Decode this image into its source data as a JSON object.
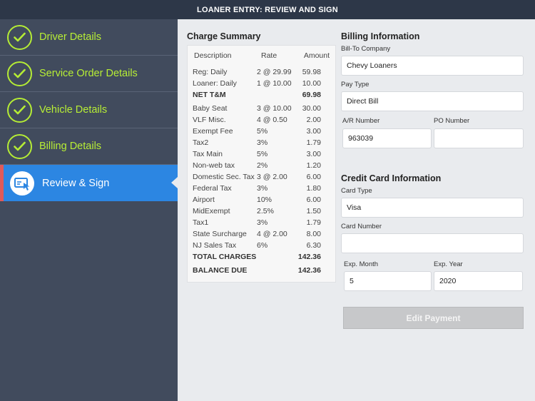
{
  "header": {
    "title": "LOANER ENTRY:  REVIEW AND SIGN"
  },
  "sidebar": {
    "items": [
      {
        "label": "Driver Details",
        "icon": "check-circle-icon"
      },
      {
        "label": "Service Order Details",
        "icon": "check-circle-icon"
      },
      {
        "label": "Vehicle Details",
        "icon": "check-circle-icon"
      },
      {
        "label": "Billing Details",
        "icon": "check-circle-icon"
      },
      {
        "label": "Review & Sign",
        "icon": "sign-document-icon"
      }
    ],
    "colors": {
      "check": "#b5ec35",
      "active": "#2c86e2",
      "active_marker": "#e05a5a",
      "background": "#414b5d"
    }
  },
  "charge_summary": {
    "title": "Charge Summary",
    "columns": {
      "description": "Description",
      "rate": "Rate",
      "amount": "Amount"
    },
    "rows": [
      {
        "description": "Reg: Daily",
        "rate": "2 @ 29.99",
        "amount": "59.98"
      },
      {
        "description": "Loaner: Daily",
        "rate": "1 @ 10.00",
        "amount": "10.00"
      },
      {
        "description": "NET T&M",
        "rate": "",
        "amount": "69.98"
      },
      {
        "description": "Baby Seat",
        "rate": "3 @ 10.00",
        "amount": "30.00"
      },
      {
        "description": "VLF Misc.",
        "rate": "4 @ 0.50",
        "amount": "2.00"
      },
      {
        "description": "Exempt Fee",
        "rate": "5%",
        "amount": "3.00"
      },
      {
        "description": "Tax2",
        "rate": "3%",
        "amount": "1.79"
      },
      {
        "description": "Tax Main",
        "rate": "5%",
        "amount": "3.00"
      },
      {
        "description": "Non-web tax",
        "rate": "2%",
        "amount": "1.20"
      },
      {
        "description": "Domestic Sec. Tax",
        "rate": "3 @ 2.00",
        "amount": "6.00"
      },
      {
        "description": "Federal Tax",
        "rate": "3%",
        "amount": "1.80"
      },
      {
        "description": "Airport",
        "rate": "10%",
        "amount": "6.00"
      },
      {
        "description": "MidExempt",
        "rate": "2.5%",
        "amount": "1.50"
      },
      {
        "description": "Tax1",
        "rate": "3%",
        "amount": "1.79"
      },
      {
        "description": "State Surcharge",
        "rate": "4 @ 2.00",
        "amount": "8.00"
      },
      {
        "description": "NJ Sales Tax",
        "rate": "6%",
        "amount": "6.30"
      },
      {
        "description": "TOTAL CHARGES",
        "rate": "",
        "amount": "142.36"
      },
      {
        "description": "BALANCE DUE",
        "rate": "",
        "amount": "142.36"
      }
    ]
  },
  "billing": {
    "title": "Billing Information",
    "bill_to_label": "Bill-To Company",
    "bill_to_value": "Chevy Loaners",
    "pay_type_label": "Pay Type",
    "pay_type_value": "Direct Bill",
    "ar_label": "A/R Number",
    "ar_value": "963039",
    "po_label": "PO Number",
    "po_value": ""
  },
  "credit_card": {
    "title": "Credit Card Information",
    "type_label": "Card Type",
    "type_value": "Visa",
    "number_label": "Card Number",
    "number_value": "",
    "exp_month_label": "Exp. Month",
    "exp_month_value": "5",
    "exp_year_label": "Exp. Year",
    "exp_year_value": "2020"
  },
  "actions": {
    "edit_payment": "Edit Payment"
  }
}
